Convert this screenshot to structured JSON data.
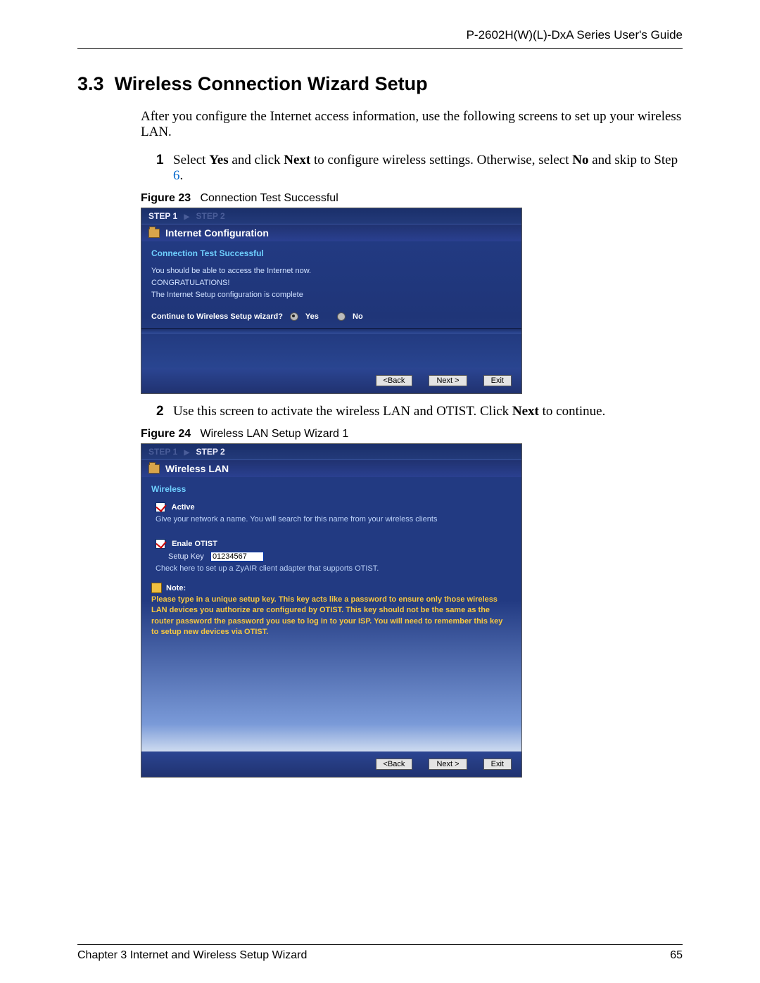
{
  "header": {
    "doc_title": "P-2602H(W)(L)-DxA Series User's Guide"
  },
  "section": {
    "number": "3.3",
    "title": "Wireless Connection Wizard Setup",
    "intro": "After you configure the Internet access information, use the following screens to set up your wireless LAN."
  },
  "step1": {
    "num": "1",
    "pre": "Select ",
    "yes": "Yes",
    "mid": " and click ",
    "next": "Next",
    "post1": " to configure wireless settings. Otherwise, select ",
    "no": "No",
    "post2": " and skip to Step ",
    "link6": "6",
    "dot": "."
  },
  "fig23": {
    "label": "Figure 23",
    "caption": "Connection Test Successful",
    "steps": {
      "s1": "STEP 1",
      "s2": "STEP 2"
    },
    "panel_title": "Internet Configuration",
    "heading": "Connection Test Successful",
    "line1": "You should be able to access the Internet now.",
    "line2": "CONGRATULATIONS!",
    "line3": "The Internet Setup configuration is complete",
    "prompt": "Continue to Wireless Setup wizard?",
    "opt_yes": "Yes",
    "opt_no": "No",
    "btn_back": "<Back",
    "btn_next": "Next >",
    "btn_exit": "Exit"
  },
  "step2": {
    "num": "2",
    "pre": "Use this screen to activate the wireless LAN and OTIST. Click ",
    "next": "Next",
    "post": " to continue."
  },
  "fig24": {
    "label": "Figure 24",
    "caption": "Wireless LAN Setup Wizard 1",
    "steps": {
      "s1": "STEP 1",
      "s2": "STEP 2"
    },
    "panel_title": "Wireless LAN",
    "heading": "Wireless",
    "active_label": "Active",
    "active_desc": "Give your network a name. You will search for this name from your wireless clients",
    "otist_label": "Enale OTIST",
    "setup_key_label": "Setup Key",
    "setup_key_value": "01234567",
    "otist_desc": "Check here to set up a ZyAIR client adapter that supports OTIST.",
    "note_label": "Note:",
    "note_body": "Please type in a unique setup key. This key acts like a password to ensure only those wireless LAN devices you authorize are configured by OTIST. This key should not be the same as the router password the password you use to log in to your ISP. You will need to remember this key to setup new devices via OTIST.",
    "btn_back": "<Back",
    "btn_next": "Next >",
    "btn_exit": "Exit"
  },
  "footer": {
    "chapter": "Chapter 3 Internet and Wireless Setup Wizard",
    "page": "65"
  }
}
